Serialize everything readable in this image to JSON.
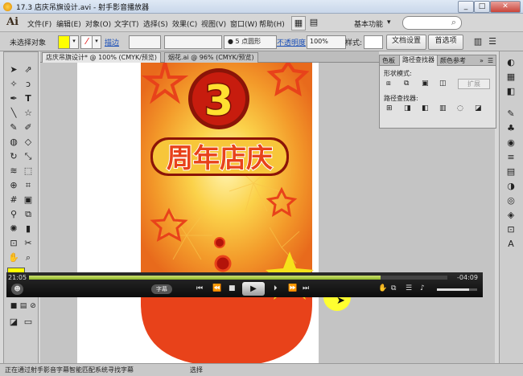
{
  "window": {
    "title": "17.3 店庆吊旗设计.avi - 射手影音播放器",
    "buttons": [
      "_",
      "□",
      "✕"
    ]
  },
  "menubar": {
    "logo": "Ai",
    "items": [
      "文件(F)",
      "编辑(E)",
      "对象(O)",
      "文字(T)",
      "选择(S)",
      "效果(C)",
      "视图(V)",
      "窗口(W)",
      "帮助(H)"
    ],
    "workspace": "基本功能"
  },
  "controlbar": {
    "selection": "未选择对象",
    "stroke_label": "描边",
    "brush": "5 点圆形",
    "opacity_label": "不透明度",
    "opacity_value": "100%",
    "style_label": "样式:",
    "doc_settings": "文档设置",
    "preferences": "首选项"
  },
  "tabs": [
    {
      "label": "店庆吊旗设计* @ 100% (CMYK/预览)"
    },
    {
      "label": "烟花.ai @ 96% (CMYK/预览)"
    }
  ],
  "artwork": {
    "number": "3",
    "headline": "周年店庆"
  },
  "panel": {
    "tabs": [
      "色板",
      "路径查找器",
      "颜色参考"
    ],
    "shape_modes_label": "形状模式:",
    "expand_button": "扩展",
    "pathfinders_label": "路径查找器:"
  },
  "player": {
    "time_current": "21:05",
    "time_remaining": "-04:09",
    "progress": 0.84,
    "subtitle_btn": "字幕",
    "volume": 0.8
  },
  "statusbar": {
    "message": "正在通过射手影音字幕智能匹配系统寻找字幕",
    "mode": "选择"
  },
  "colors": {
    "fill": "#ffff00",
    "accent_orange": "#f07820",
    "banner_red": "#e8421a"
  }
}
